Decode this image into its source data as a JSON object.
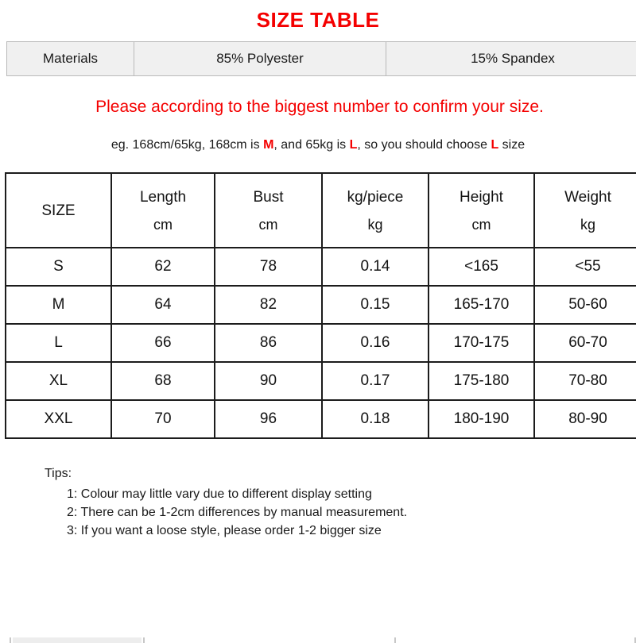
{
  "title": "SIZE TABLE",
  "colors": {
    "accent_red": "#f40000",
    "text_black": "#1a1a1a",
    "materials_bg": "#f0f0f0",
    "table_border": "#1c1c1c"
  },
  "materials": {
    "label": "Materials",
    "composition_1": "85% Polyester",
    "composition_2": "15% Spandex"
  },
  "notice": {
    "main": "Please according to the biggest number to confirm your size.",
    "example": {
      "part1": "eg. 168cm/65kg, 168cm is ",
      "hl1": "M",
      "part2": ", and 65kg is ",
      "hl2": "L",
      "part3": ", so you should choose ",
      "hl3": "L",
      "part4": " size"
    }
  },
  "chart_data": {
    "type": "table",
    "title": "SIZE TABLE",
    "headers": [
      {
        "name": "SIZE",
        "unit": ""
      },
      {
        "name": "Length",
        "unit": "cm"
      },
      {
        "name": "Bust",
        "unit": "cm"
      },
      {
        "name": "kg/piece",
        "unit": "kg"
      },
      {
        "name": "Height",
        "unit": "cm"
      },
      {
        "name": "Weight",
        "unit": "kg"
      }
    ],
    "rows": [
      {
        "size": "S",
        "length": "62",
        "bust": "78",
        "kg_piece": "0.14",
        "height": "<165",
        "weight": "<55"
      },
      {
        "size": "M",
        "length": "64",
        "bust": "82",
        "kg_piece": "0.15",
        "height": "165-170",
        "weight": "50-60"
      },
      {
        "size": "L",
        "length": "66",
        "bust": "86",
        "kg_piece": "0.16",
        "height": "170-175",
        "weight": "60-70"
      },
      {
        "size": "XL",
        "length": "68",
        "bust": "90",
        "kg_piece": "0.17",
        "height": "175-180",
        "weight": "70-80"
      },
      {
        "size": "XXL",
        "length": "70",
        "bust": "96",
        "kg_piece": "0.18",
        "height": "180-190",
        "weight": "80-90"
      }
    ]
  },
  "tips": {
    "heading": "Tips:",
    "items": [
      "1: Colour may little vary due to different display setting",
      "2: There can be 1-2cm differences by manual measurement.",
      "3: If you want a loose style, please order 1-2 bigger size"
    ]
  }
}
